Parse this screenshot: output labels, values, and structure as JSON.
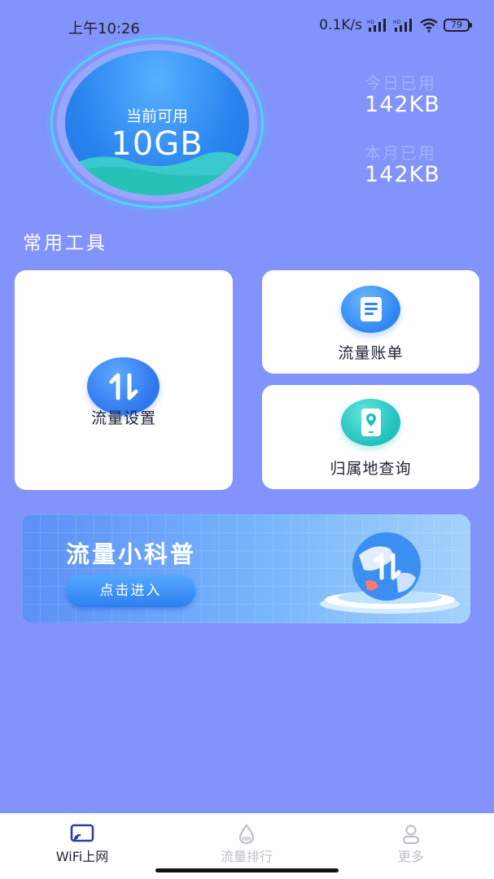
{
  "status_bar": {
    "time": "上午10:26",
    "net_speed": "0.1K/s",
    "battery": "79"
  },
  "data_circle": {
    "label": "当前可用",
    "value": "10GB"
  },
  "usage": {
    "today_label": "今日已用",
    "today_value": "142KB",
    "month_label": "本月已用",
    "month_value": "142KB"
  },
  "tools": {
    "section_title": "常用工具",
    "traffic_settings": "流量设置",
    "traffic_bill": "流量账单",
    "location_query": "归属地查询"
  },
  "banner": {
    "title": "流量小科普",
    "button": "点击进入"
  },
  "bottom_nav": {
    "items": [
      {
        "label": "WiFi上网",
        "icon": "wifi-cast-icon",
        "active": true
      },
      {
        "label": "流量排行",
        "icon": "droplet-icon",
        "active": false
      },
      {
        "label": "更多",
        "icon": "user-icon",
        "active": false
      }
    ]
  },
  "colors": {
    "background": "#8293fb",
    "accent_blue": "#2a85f0",
    "accent_teal": "#2fc6c2",
    "nav_active": "#2a3ea8",
    "nav_inactive": "#c0c0c8"
  }
}
